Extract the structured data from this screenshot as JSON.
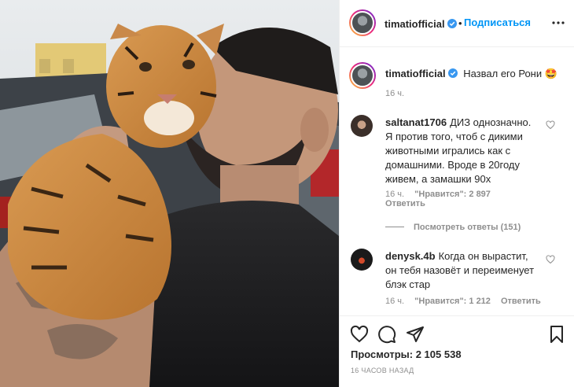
{
  "post": {
    "username": "timatiofficial",
    "follow_label": "Подписаться",
    "separator": "•",
    "caption": "Назвал его Рони 🤩",
    "caption_time": "16 ч."
  },
  "comments": [
    {
      "username": "saltanat1706",
      "text": "ДИЗ однозначно. Я против того, чтоб с дикими животными игрались как с домашними. Вроде в 20году живем, а замашки 90х",
      "time": "16 ч.",
      "likes": "\"Нравится\": 2 897",
      "reply_label": "Ответить",
      "view_replies": "Посмотреть ответы (151)"
    },
    {
      "username": "denysk.4b",
      "text": "Когда он вырастит, он тебя назовёт и переименует блэк стар",
      "time": "16 ч.",
      "likes": "\"Нравится\": 1 212",
      "reply_label": "Ответить"
    }
  ],
  "stats": {
    "views_label": "Просмотры:",
    "views_value": "2 105 538",
    "time_ago": "16 ЧАСОВ НАЗАД"
  },
  "icons": {
    "verified": "verified-badge-icon",
    "more": "more-options-icon",
    "like": "heart-icon",
    "comment": "comment-icon",
    "share": "paper-plane-icon",
    "save": "bookmark-icon"
  },
  "colors": {
    "accent": "#0095f6",
    "text": "#262626",
    "muted": "#8e8e8e",
    "border": "#efefef"
  }
}
